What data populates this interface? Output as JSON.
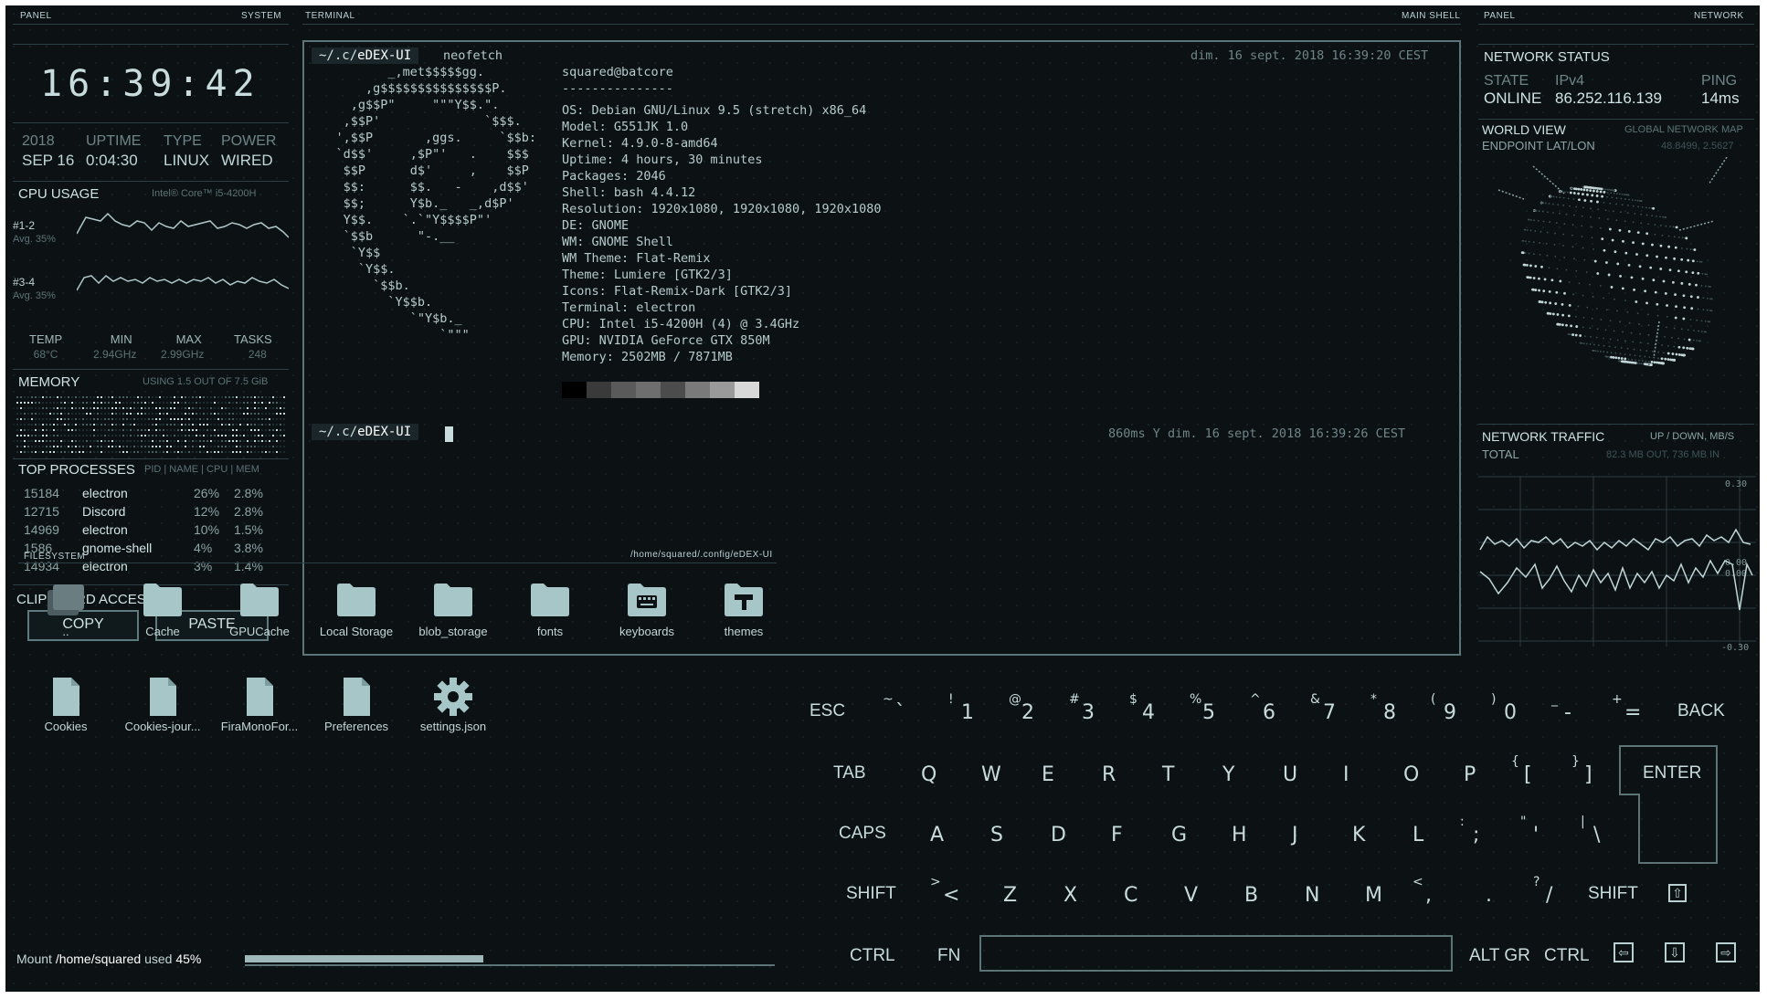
{
  "headers": {
    "left_panel": "PANEL",
    "left_system": "SYSTEM",
    "terminal": "TERMINAL",
    "main_shell": "MAIN SHELL",
    "right_panel": "PANEL",
    "right_network": "NETWORK",
    "filesystem": "FILESYSTEM",
    "fs_path": "/home/squared/.config/eDEX-UI"
  },
  "clock": "16:39:42",
  "system": {
    "year": "2018",
    "date": "SEP 16",
    "uptime_label": "UPTIME",
    "uptime": "0:04:30",
    "type_label": "TYPE",
    "type": "LINUX",
    "power_label": "POWER",
    "power": "WIRED"
  },
  "cpu": {
    "title": "CPU USAGE",
    "model": "Intel® Core™ i5-4200H",
    "core1_label": "#1-2",
    "core1_avg": "Avg. 35%",
    "core2_label": "#3-4",
    "core2_avg": "Avg. 35%",
    "stats": [
      {
        "k": "TEMP",
        "v": "68°C"
      },
      {
        "k": "MIN",
        "v": "2.94GHz"
      },
      {
        "k": "MAX",
        "v": "2.99GHz"
      },
      {
        "k": "TASKS",
        "v": "248"
      }
    ]
  },
  "memory": {
    "title": "MEMORY",
    "usage": "USING 1.5 OUT OF 7.5 GiB"
  },
  "processes": {
    "title": "TOP PROCESSES",
    "columns": "PID | NAME | CPU | MEM",
    "rows": [
      {
        "pid": "15184",
        "name": "electron",
        "cpu": "26%",
        "mem": "2.8%"
      },
      {
        "pid": "12715",
        "name": "Discord",
        "cpu": "12%",
        "mem": "2.8%"
      },
      {
        "pid": "14969",
        "name": "electron",
        "cpu": "10%",
        "mem": "1.5%"
      },
      {
        "pid": "1586",
        "name": "gnome-shell",
        "cpu": "4%",
        "mem": "3.8%"
      },
      {
        "pid": "14934",
        "name": "electron",
        "cpu": "3%",
        "mem": "1.4%"
      }
    ]
  },
  "clipboard": {
    "title": "CLIPBOARD ACCESS",
    "copy": "COPY",
    "paste": "PASTE"
  },
  "terminal": {
    "prompt_path": "~/.c/",
    "prompt_dir": "eDEX-UI",
    "command": "neofetch",
    "timestamp1": "dim. 16 sept. 2018 16:39:20 CEST",
    "timestamp2": "860ms Y dim. 16 sept. 2018 16:39:26 CEST",
    "user": "squared@batcore",
    "separator": "---------------",
    "info": [
      "OS: Debian GNU/Linux 9.5 (stretch) x86_64",
      "Model: G551JK 1.0",
      "Kernel: 4.9.0-8-amd64",
      "Uptime: 4 hours, 30 minutes",
      "Packages: 2046",
      "Shell: bash 4.4.12",
      "Resolution: 1920x1080, 1920x1080, 1920x1080",
      "DE: GNOME",
      "WM: GNOME Shell",
      "WM Theme: Flat-Remix",
      "Theme: Lumiere [GTK2/3]",
      "Icons: Flat-Remix-Dark [GTK2/3]",
      "Terminal: electron",
      "CPU: Intel i5-4200H (4) @ 3.4GHz",
      "GPU: NVIDIA GeForce GTX 850M",
      "Memory: 2502MB / 7871MB"
    ],
    "logo": [
      "           _,met$$$$$gg.",
      "        ,g$$$$$$$$$$$$$$$P.",
      "      ,g$$P\"     \"\"\"Y$$.\".",
      "     ,$$P'              `$$$.",
      "    ',$$P       ,ggs.     `$$b:",
      "    `d$$'     ,$P\"'   .    $$$",
      "     $$P      d$'     ,    $$P",
      "     $$:      $$.   -    ,d$$'",
      "     $$;      Y$b._   _,d$P'",
      "     Y$$.    `.`\"Y$$$$P\"'",
      "     `$$b      \"-.__",
      "      `Y$$",
      "       `Y$$.",
      "         `$$b.",
      "           `Y$$b.",
      "              `\"Y$b._",
      "                  `\"\"\""
    ],
    "palette": [
      "#000000",
      "#3a3a3a",
      "#5a5a5a",
      "#6e6e6e",
      "#4c4c4c",
      "#7a7a7a",
      "#9a9a9a",
      "#d8d8d8"
    ]
  },
  "network": {
    "title": "NETWORK STATUS",
    "state_label": "STATE",
    "state": "ONLINE",
    "ipv4_label": "IPv4",
    "ipv4": "86.252.116.139",
    "ping_label": "PING",
    "ping": "14ms",
    "world_title": "WORLD VIEW",
    "world_sub": "GLOBAL NETWORK MAP",
    "endpoint_label": "ENDPOINT LAT/LON",
    "endpoint": "48.8499, 2.5627",
    "traffic_title": "NETWORK TRAFFIC",
    "traffic_units": "UP / DOWN, MB/S",
    "total_label": "TOTAL",
    "total": "82.3 MB OUT, 736 MB IN",
    "scale": [
      "0.30",
      "0.00",
      "0.00",
      "-0.30"
    ]
  },
  "files": [
    {
      "name": "..",
      "icon": "folder-up-icon"
    },
    {
      "name": "Cache",
      "icon": "folder-icon"
    },
    {
      "name": "GPUCache",
      "icon": "folder-icon"
    },
    {
      "name": "Local Storage",
      "icon": "folder-icon"
    },
    {
      "name": "blob_storage",
      "icon": "folder-icon"
    },
    {
      "name": "fonts",
      "icon": "folder-icon"
    },
    {
      "name": "keyboards",
      "icon": "keyboard-folder-icon"
    },
    {
      "name": "themes",
      "icon": "theme-folder-icon"
    },
    {
      "name": "Cookies",
      "icon": "file-icon"
    },
    {
      "name": "Cookies-jour...",
      "icon": "file-icon"
    },
    {
      "name": "FiraMonoFor...",
      "icon": "file-icon"
    },
    {
      "name": "Preferences",
      "icon": "file-icon"
    },
    {
      "name": "settings.json",
      "icon": "gear-icon"
    }
  ],
  "mount": {
    "prefix": "Mount",
    "path": "/home/squared",
    "used_label": "used",
    "used": "45%",
    "fraction": 0.45
  },
  "keyboard": {
    "row1": [
      {
        "k": "ESC",
        "w": true
      },
      {
        "k": "`",
        "s": "~"
      },
      {
        "k": "1",
        "s": "!"
      },
      {
        "k": "2",
        "s": "@"
      },
      {
        "k": "3",
        "s": "#"
      },
      {
        "k": "4",
        "s": "$"
      },
      {
        "k": "5",
        "s": "%"
      },
      {
        "k": "6",
        "s": "^"
      },
      {
        "k": "7",
        "s": "&"
      },
      {
        "k": "8",
        "s": "*"
      },
      {
        "k": "9",
        "s": "("
      },
      {
        "k": "0",
        "s": ")"
      },
      {
        "k": "-",
        "s": "_"
      },
      {
        "k": "=",
        "s": "+"
      },
      {
        "k": "BACK",
        "w": true
      }
    ],
    "row2": [
      "TAB",
      "Q",
      "W",
      "E",
      "R",
      "T",
      "Y",
      "U",
      "I",
      "O",
      "P",
      "[",
      "]",
      "ENTER"
    ],
    "row2_shift": {
      "[": "{",
      "]": "}"
    },
    "row3": [
      "CAPS",
      "A",
      "S",
      "D",
      "F",
      "G",
      "H",
      "J",
      "K",
      "L",
      ";",
      "'",
      "\\"
    ],
    "row3_shift": {
      ";": ":",
      "'": "\"",
      "\\": "|"
    },
    "row4": [
      "SHIFT",
      "<",
      "Z",
      "X",
      "C",
      "V",
      "B",
      "N",
      "M",
      ",",
      ".",
      "/",
      "SHIFT"
    ],
    "row4_shift": {
      "<": ">",
      ",": "<",
      ".": ">",
      "/": "?"
    },
    "row5": [
      "CTRL",
      "FN",
      "ALT GR",
      "CTRL"
    ]
  }
}
